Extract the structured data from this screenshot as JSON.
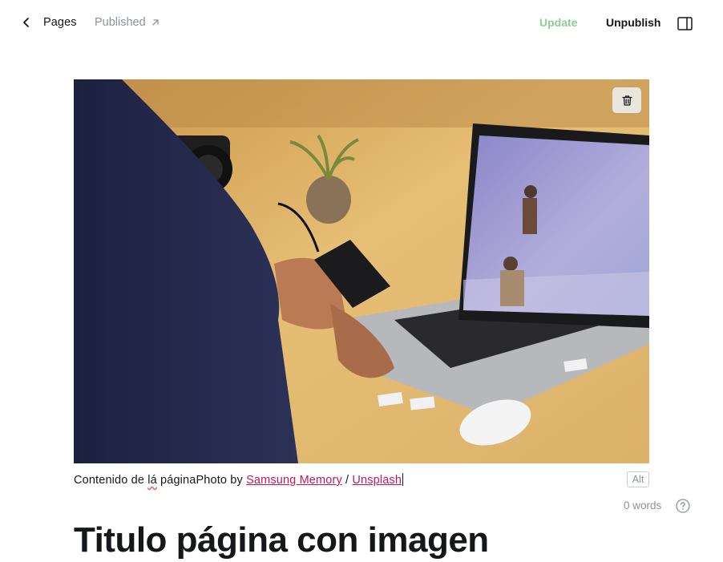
{
  "header": {
    "back_label": "Pages",
    "status_label": "Published",
    "update_label": "Update",
    "unpublish_label": "Unpublish",
    "colors": {
      "update": "#8bd08f",
      "muted": "#8e9399"
    }
  },
  "feature_image": {
    "alt_button_label": "Alt"
  },
  "caption": {
    "text_before": "Contenido de ",
    "misspelled_word": "lá",
    "text_middle": " páginaPhoto by ",
    "author_link": "Samsung Memory",
    "separator": " / ",
    "source_link": "Unsplash",
    "link_color": "#c2185b"
  },
  "editor": {
    "word_count": "0 words",
    "title": "Titulo página con imagen"
  },
  "icons": {
    "back": "chevron-left-icon",
    "external": "arrow-up-right-icon",
    "sidebar": "sidebar-toggle-icon",
    "delete": "trash-icon",
    "help": "question-circle-icon"
  }
}
